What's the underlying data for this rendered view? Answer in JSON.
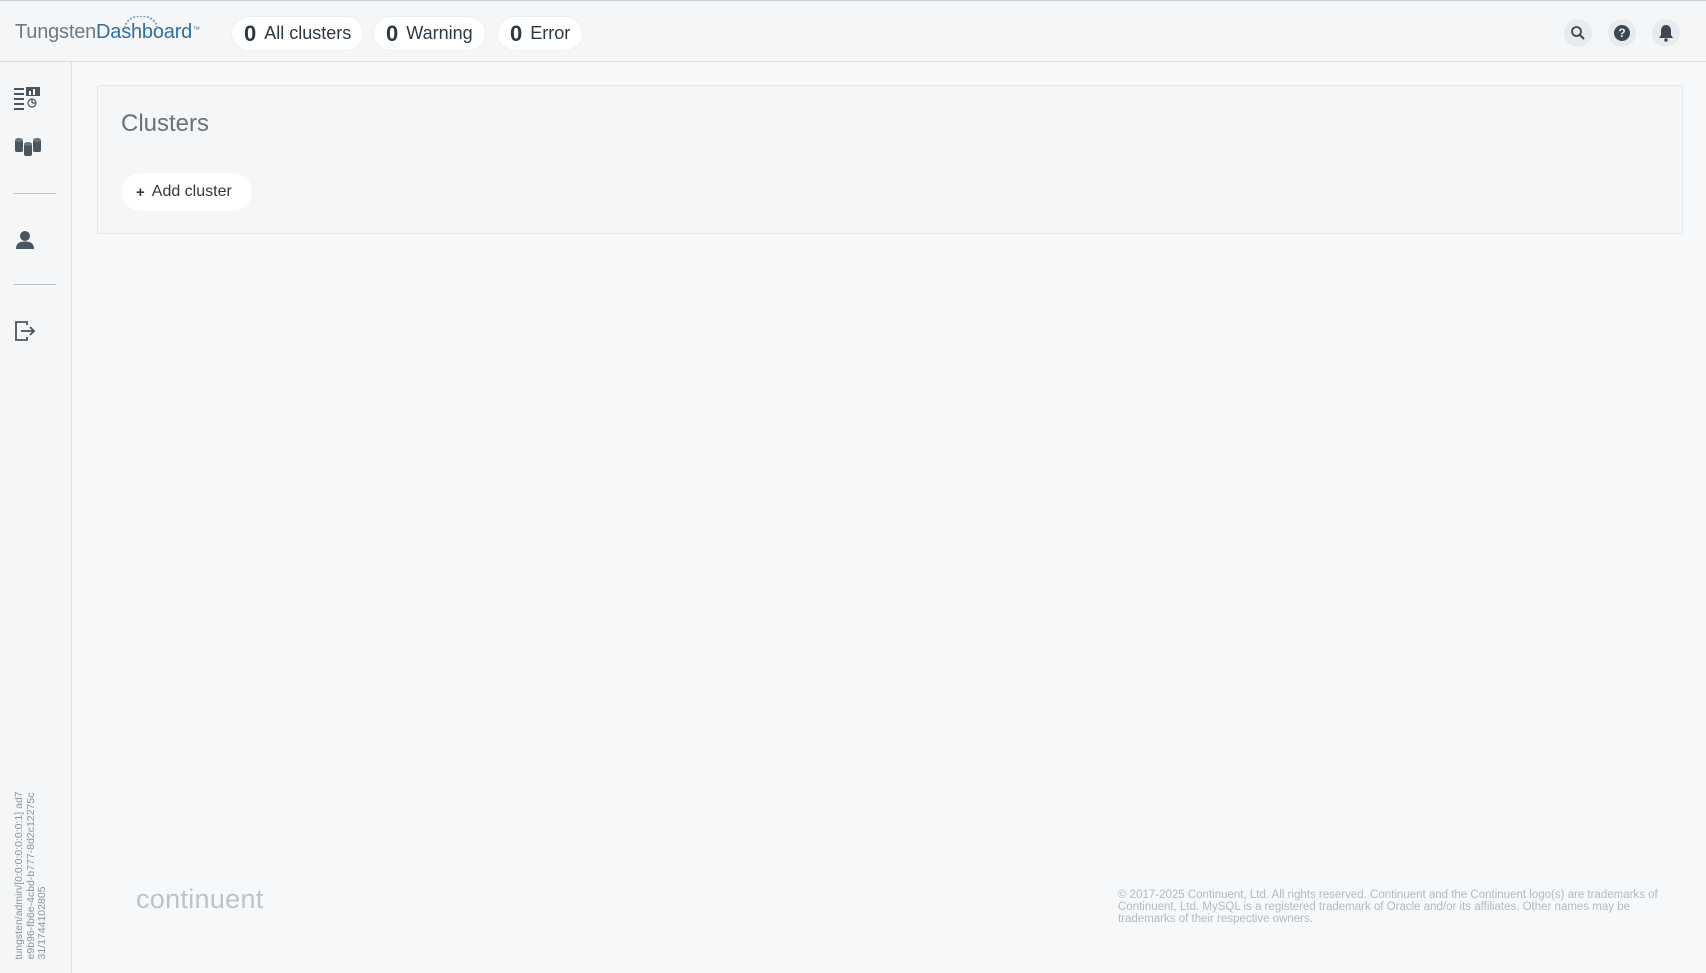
{
  "header": {
    "logo_part1": "Tungsten",
    "logo_part2": "Dashboard",
    "logo_tm": "™",
    "counters": [
      {
        "value": "0",
        "label": "All clusters"
      },
      {
        "value": "0",
        "label": "Warning"
      },
      {
        "value": "0",
        "label": "Error"
      }
    ],
    "icons": [
      "search-icon",
      "help-icon",
      "bell-icon"
    ]
  },
  "sidebar": {
    "items": [
      "dashboard-icon",
      "clusters-icon",
      "user-icon",
      "logout-icon"
    ],
    "session_info": "tungsten/admin/[0:0:0:0:0:0:0:1] ad7e9b96-fb6e-4cbd-b777-8d2c12275c31/1744102805"
  },
  "main": {
    "title": "Clusters",
    "add_button_icon": "+",
    "add_button_label": "Add cluster"
  },
  "footer": {
    "logo": "continuent",
    "copyright": "© 2017-2025 Continuent, Ltd. All rights reserved. Continuent and the Continuent logo(s) are trademarks of Continuent, Ltd. MySQL is a registered trademark of Oracle and/or its affiliates. Other names may be trademarks of their respective owners."
  },
  "colors": {
    "background": "#f6f8fa",
    "brand_blue": "#2f6fa3",
    "text_dark": "#2c3842"
  }
}
